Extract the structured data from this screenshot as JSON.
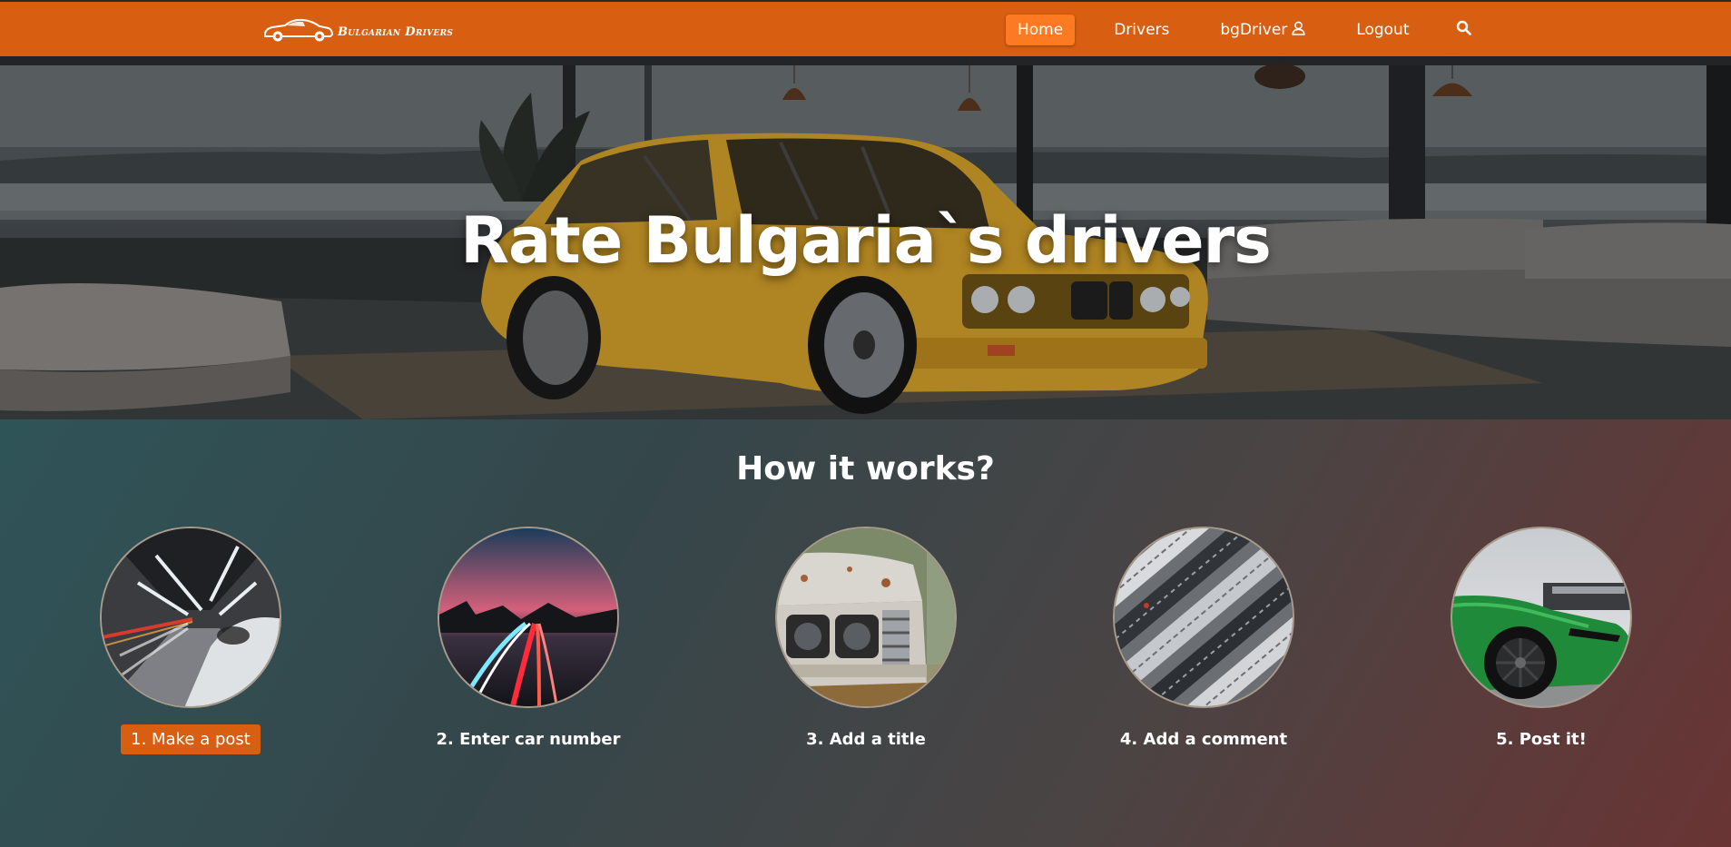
{
  "navbar": {
    "brand": "Bulgarian Drivers",
    "links": [
      {
        "label": "Home",
        "active": true
      },
      {
        "label": "Drivers",
        "active": false
      },
      {
        "label": "bgDriver",
        "active": false,
        "icon": "user-icon"
      },
      {
        "label": "Logout",
        "active": false
      },
      {
        "label": "",
        "icon": "search-icon"
      }
    ],
    "color": "#d85f12",
    "active_color": "#fb7a22"
  },
  "hero": {
    "title": "Rate Bulgaria`s drivers"
  },
  "how_it_works": {
    "title": "How it works?",
    "steps": [
      {
        "label": "1. Make a post",
        "active": true
      },
      {
        "label": "2. Enter car number",
        "active": false
      },
      {
        "label": "3. Add a title",
        "active": false
      },
      {
        "label": "4. Add a comment",
        "active": false
      },
      {
        "label": "5. Post it!",
        "active": false
      }
    ]
  }
}
